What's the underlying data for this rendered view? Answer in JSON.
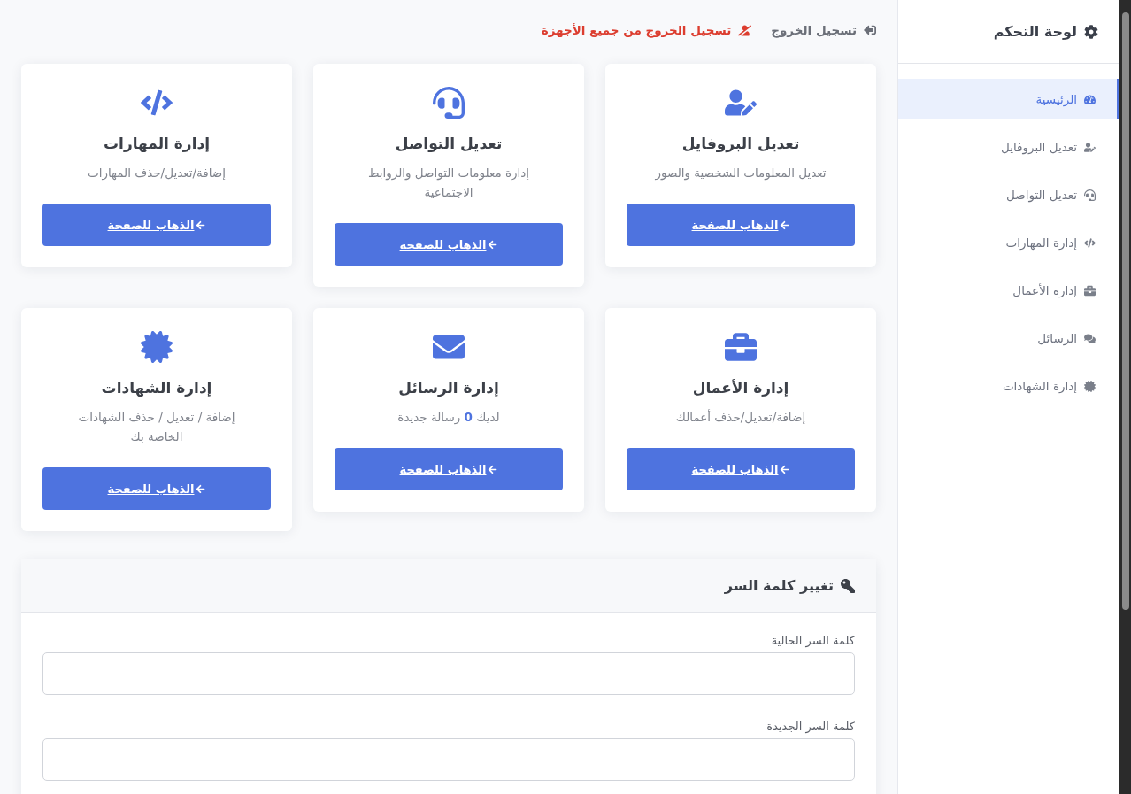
{
  "sidebar": {
    "title": "لوحة التحكم",
    "items": [
      {
        "label": "الرئيسية",
        "selected": true
      },
      {
        "label": "تعديل البروفايل",
        "selected": false
      },
      {
        "label": "تعديل التواصل",
        "selected": false
      },
      {
        "label": "إدارة المهارات",
        "selected": false
      },
      {
        "label": "إدارة الأعمال",
        "selected": false
      },
      {
        "label": "الرسائل",
        "selected": false
      },
      {
        "label": "إدارة الشهادات",
        "selected": false
      }
    ]
  },
  "top_links": [
    {
      "label": "تسجيل الخروج",
      "kind": "normal"
    },
    {
      "label": "تسجيل الخروج من جميع الأجهزة",
      "kind": "danger"
    }
  ],
  "cards": [
    {
      "title": "تعديل البروفايل",
      "description": "تعديل المعلومات الشخصية والصور",
      "button": "الذهاب للصفحة"
    },
    {
      "title": "تعديل التواصل",
      "description": "إدارة معلومات التواصل والروابط الاجتماعية",
      "button": "الذهاب للصفحة"
    },
    {
      "title": "إدارة المهارات",
      "description": "إضافة/تعديل/حذف المهارات",
      "button": "الذهاب للصفحة"
    },
    {
      "title": "إدارة الأعمال",
      "description": "إضافة/تعديل/حذف أعمالك",
      "button": "الذهاب للصفحة"
    },
    {
      "title": "إدارة الرسائل",
      "description": "لديك **0** رسالة جديدة",
      "button": "الذهاب للصفحة"
    },
    {
      "title": "إدارة الشهادات",
      "description": "إضافة / تعديل / حذف الشهادات الخاصة بك",
      "button": "الذهاب للصفحة"
    }
  ],
  "password_form": {
    "title": "تغيير كلمة السر",
    "fields": [
      {
        "label": "كلمة السر الحالية"
      },
      {
        "label": "كلمة السر الجديدة"
      }
    ]
  }
}
